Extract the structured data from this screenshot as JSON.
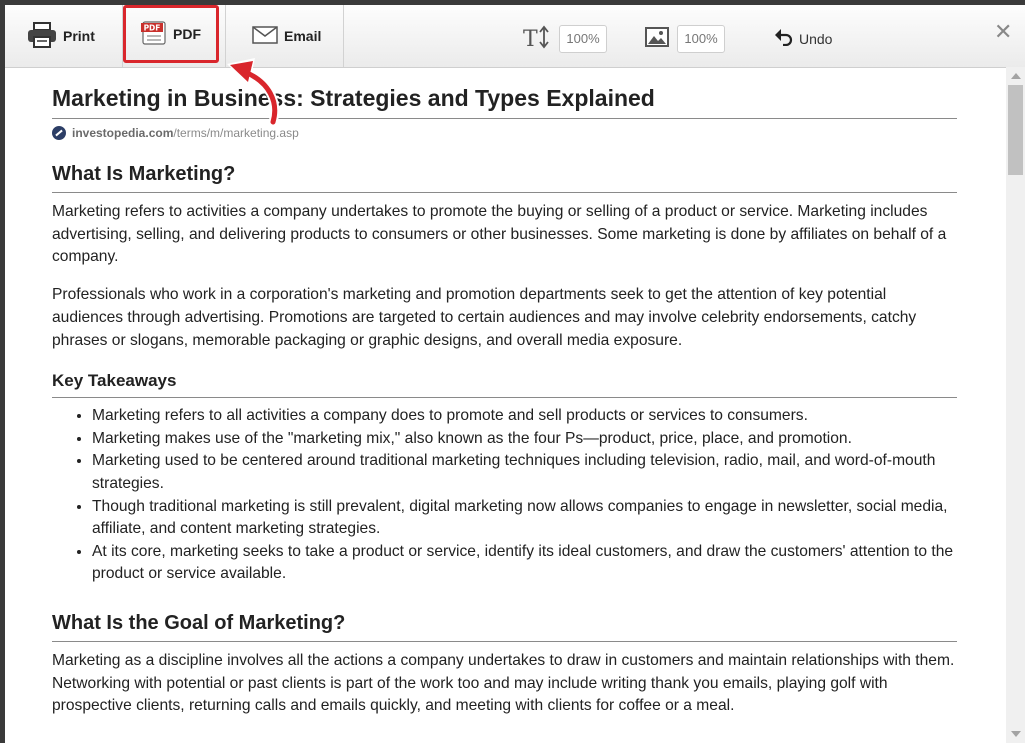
{
  "toolbar": {
    "print_label": "Print",
    "pdf_label": "PDF",
    "email_label": "Email",
    "text_zoom": "100%",
    "image_zoom": "100%",
    "undo_label": "Undo",
    "close_symbol": "✕",
    "pdf_icon_text": "PDF",
    "highlight_color": "#d9262c"
  },
  "article": {
    "title": "Marketing in Business: Strategies and Types Explained",
    "source_domain": "investopedia.com",
    "source_path": "/terms/m/marketing.asp",
    "sections": [
      {
        "heading": "What Is Marketing?",
        "paragraphs": [
          "Marketing refers to activities a company undertakes to promote the buying or selling of a product or service. Marketing includes advertising, selling, and delivering products to consumers or other businesses. Some marketing is done by affiliates on behalf of a company.",
          "Professionals who work in a corporation's marketing and promotion departments seek to get the attention of key potential audiences through advertising. Promotions are targeted to certain audiences and may involve celebrity endorsements, catchy phrases or slogans, memorable packaging or graphic designs, and overall media exposure."
        ]
      },
      {
        "heading": "Key Takeaways",
        "bullets": [
          "Marketing refers to all activities a company does to promote and sell products or services to consumers.",
          "Marketing makes use of the \"marketing mix,\" also known as the four Ps—product, price, place, and promotion.",
          "Marketing used to be centered around traditional marketing techniques including television, radio, mail, and word-of-mouth strategies.",
          "Though traditional marketing is still prevalent, digital marketing now allows companies to engage in newsletter, social media, affiliate, and content marketing strategies.",
          "At its core, marketing seeks to take a product or service, identify its ideal customers, and draw the customers' attention to the product or service available."
        ]
      },
      {
        "heading": "What Is the Goal of Marketing?",
        "paragraphs": [
          "Marketing as a discipline involves all the actions a company undertakes to draw in customers and maintain relationships with them. Networking with potential or past clients is part of the work too and may include writing thank you emails, playing golf with prospective clients, returning calls and emails quickly, and meeting with clients for coffee or a meal."
        ]
      }
    ]
  }
}
